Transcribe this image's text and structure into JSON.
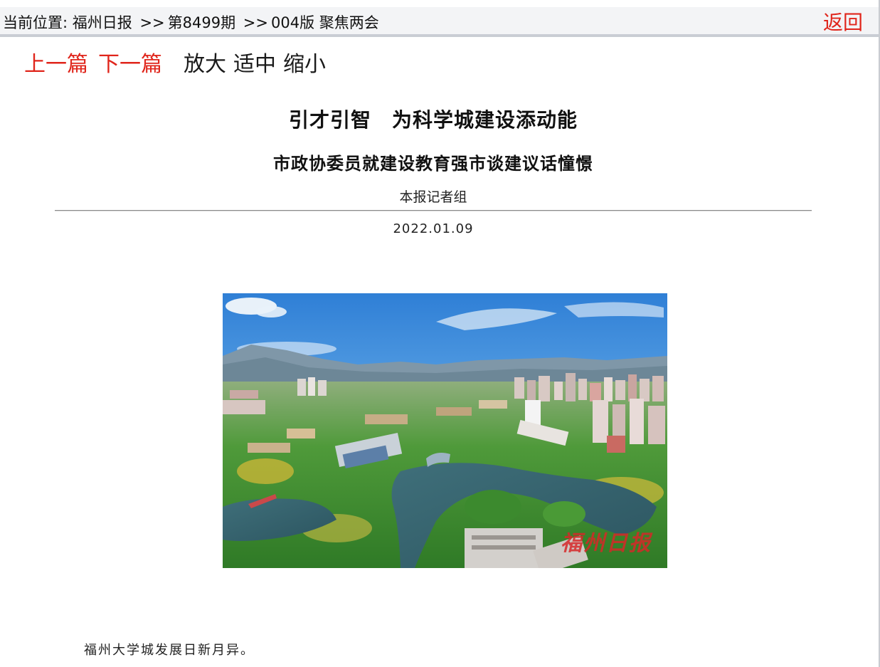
{
  "location": {
    "prefix": "当前位置:",
    "paper": "福州日报",
    "separator": ">>",
    "issue": "第8499期",
    "section": "004版 聚焦两会"
  },
  "back_label": "返回",
  "nav": {
    "prev": "上一篇",
    "next": "下一篇",
    "zoom_in": "放大",
    "zoom_fit": "适中",
    "zoom_out": "缩小"
  },
  "article": {
    "title": "引才引智　为科学城建设添动能",
    "subtitle": "市政协委员就建设教育强市谈建议话憧憬",
    "author": "本报记者组",
    "date": "2022.01.09",
    "photo_watermark": "福州日报",
    "caption": "福州大学城发展日新月异。"
  },
  "colors": {
    "link_red": "#e0251b",
    "topbar_bg": "#f3f4f6"
  }
}
